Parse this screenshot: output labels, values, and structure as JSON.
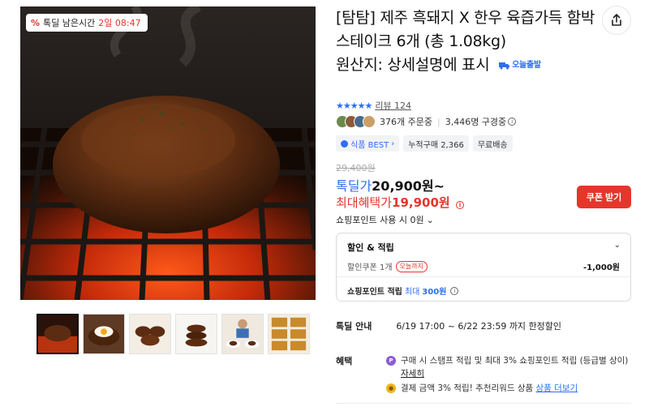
{
  "gallery": {
    "timer_label": "톡딜 남은시간",
    "timer_value": "2일 08:47",
    "thumbnails": [
      "thumb-1",
      "thumb-2",
      "thumb-3",
      "thumb-4",
      "thumb-5",
      "thumb-6"
    ]
  },
  "product": {
    "title": "[탐탐] 제주 흑돼지 X 한우 육즙가득 함박스테이크 6개 (총 1.08kg)",
    "origin": "원산지: 상세설명에 표시",
    "today_badge": "오늘출발",
    "rating_stars": "★★★★★",
    "review_text": "리뷰 124",
    "orders": "376개 주문중",
    "viewers": "3,446명 구경중"
  },
  "tags": [
    "식품 BEST",
    "누적구매 2,366",
    "무료배송"
  ],
  "price": {
    "original": "29,400원",
    "deal_label": "톡딜가",
    "deal_value": "20,900원~",
    "max_label": "최대혜택가",
    "max_value": "19,900원",
    "coupon_button": "쿠폰 받기",
    "points_use": "쇼핑포인트 사용 시 0원"
  },
  "discount_box": {
    "title": "할인 & 적립",
    "coupon_label": "할인쿠폰 1개",
    "coupon_chip": "오늘까지",
    "coupon_amount": "-1,000원",
    "points_label": "쇼핑포인트 적립",
    "points_max_label": "최대",
    "points_max_value": "300원"
  },
  "deal": {
    "label": "톡딜 안내",
    "value": "6/19 17:00 ~ 6/22 23:59 까지 한정할인"
  },
  "benefits": {
    "label": "혜택",
    "line1": "구매 시 스탬프 적립 및 최대 3% 쇼핑포인트 적립 (등급별 상이)",
    "line1_link": "자세히",
    "line2": "결제 금액 3% 적립! 추천리워드 상품",
    "line2_link": "상품 더보기"
  },
  "colors": {
    "accent_blue": "#2f6df6",
    "accent_red": "#e5362b"
  },
  "icons": {
    "share": "share-icon",
    "info": "info-icon",
    "chevron": "chevron-down-icon"
  }
}
